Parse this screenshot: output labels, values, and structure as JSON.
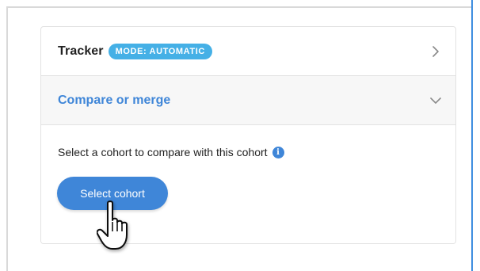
{
  "tracker": {
    "label": "Tracker",
    "mode_badge": "MODE: AUTOMATIC"
  },
  "compare": {
    "label": "Compare or merge"
  },
  "body": {
    "help_text": "Select a cohort to compare with this cohort",
    "info_icon": "info-icon",
    "button_label": "Select cohort"
  },
  "colors": {
    "accent": "#3f86d8",
    "badge": "#45b0e6",
    "border": "#e2e2e2",
    "row_bg_alt": "#f7f7f7"
  },
  "icons": {
    "tracker_chevron": "chevron-right-icon",
    "compare_chevron": "chevron-down-icon",
    "pointer": "hand-pointer-icon"
  }
}
